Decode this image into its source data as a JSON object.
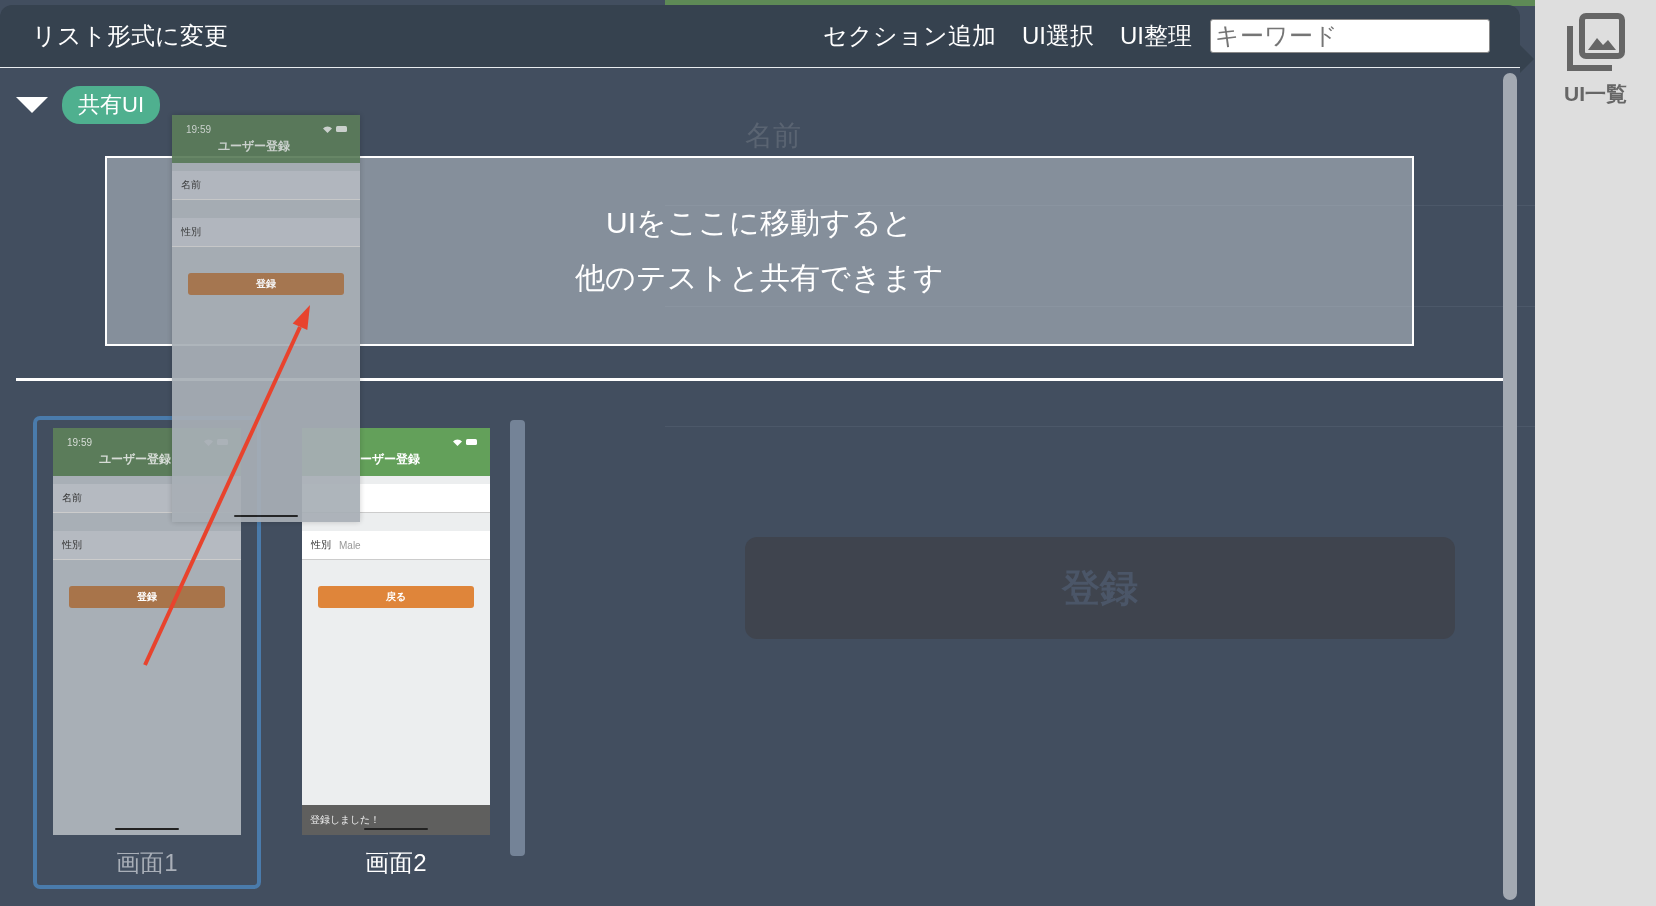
{
  "background_editor": {
    "field_label": "名前",
    "submit": "登録"
  },
  "toolbar": {
    "title_button": "リスト形式に変更",
    "actions": [
      "セクション追加",
      "UI選択",
      "UI整理"
    ],
    "search": {
      "placeholder": "キーワード"
    }
  },
  "sidebar": {
    "button": "UI一覧"
  },
  "shared_section": {
    "expanded": true,
    "badge": "共有UI",
    "drop_zone": {
      "lines": [
        "UIをここに移動すると",
        "他のテストと共有できます"
      ]
    }
  },
  "dragged_screen": {
    "time": "19:59",
    "title": "ユーザー登録",
    "fields": [
      {
        "label": "名前"
      },
      {
        "label": "性別"
      }
    ],
    "button": "登録"
  },
  "screens": [
    {
      "label": "画面1",
      "selected": true,
      "dimmed": true,
      "screen": {
        "time": "19:59",
        "title": "ユーザー登録",
        "fields": [
          {
            "label": "名前"
          },
          {
            "label": "性別"
          }
        ],
        "button": "登録"
      }
    },
    {
      "label": "画面2",
      "selected": false,
      "dimmed": false,
      "screen": {
        "title": "ーザー登録",
        "fields": [
          {
            "label": "性別",
            "value": "Male"
          }
        ],
        "button": "戻る",
        "toast": "登録しました！"
      }
    }
  ]
}
